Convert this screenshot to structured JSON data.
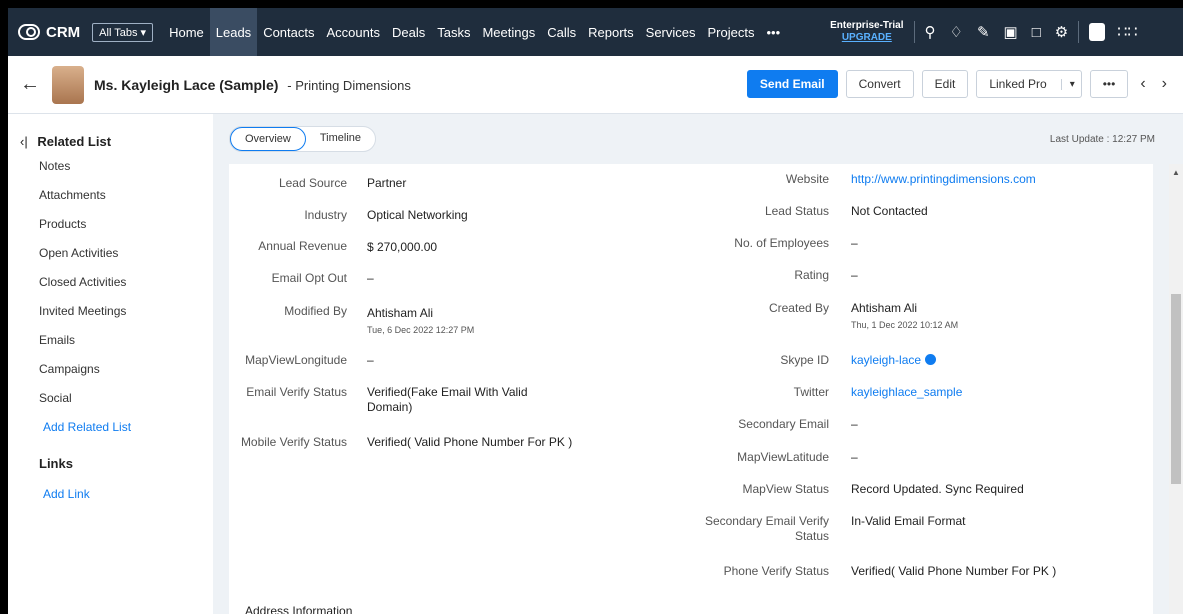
{
  "nav": {
    "logo": "CRM",
    "all_tabs": "All Tabs ▾",
    "items": [
      "Home",
      "Leads",
      "Contacts",
      "Accounts",
      "Deals",
      "Tasks",
      "Meetings",
      "Calls",
      "Reports",
      "Services",
      "Projects",
      "•••"
    ],
    "trial": "Enterprise-Trial",
    "upgrade": "UPGRADE"
  },
  "header": {
    "title": "Ms. Kayleigh Lace (Sample)",
    "company": "- Printing Dimensions",
    "send_email": "Send Email",
    "convert": "Convert",
    "edit": "Edit",
    "linked": "Linked Pro",
    "more": "•••"
  },
  "sidebar": {
    "title": "Related List",
    "items": [
      "Notes",
      "Attachments",
      "Products",
      "Open Activities",
      "Closed Activities",
      "Invited Meetings",
      "Emails",
      "Campaigns",
      "Social"
    ],
    "add_related": "Add Related List",
    "links_title": "Links",
    "add_link": "Add Link"
  },
  "tabs": {
    "overview": "Overview",
    "timeline": "Timeline"
  },
  "last_update": "Last Update : 12:27 PM",
  "left_fields": [
    {
      "label": "Lead Source",
      "value": "Partner"
    },
    {
      "label": "Industry",
      "value": "Optical Networking"
    },
    {
      "label": "Annual Revenue",
      "value": "$ 270,000.00"
    },
    {
      "label": "Email Opt Out",
      "value": "–"
    },
    {
      "label": "Modified By",
      "value": "Ahtisham Ali",
      "sub": "Tue, 6 Dec 2022 12:27 PM"
    },
    {
      "label": "MapViewLongitude",
      "value": "–"
    },
    {
      "label": "Email Verify Status",
      "value": "Verified(Fake Email With Valid Domain)"
    },
    {
      "label": "Mobile Verify Status",
      "value": "Verified( Valid Phone Number For PK )"
    }
  ],
  "right_fields": [
    {
      "label": "Website",
      "value": "http://www.printingdimensions.com"
    },
    {
      "label": "Lead Status",
      "value": "Not Contacted"
    },
    {
      "label": "No. of Employees",
      "value": "–"
    },
    {
      "label": "Rating",
      "value": "–"
    },
    {
      "label": "Created By",
      "value": "Ahtisham Ali",
      "sub": "Thu, 1 Dec 2022 10:12 AM"
    },
    {
      "label": "Skype ID",
      "value": "kayleigh-lace"
    },
    {
      "label": "Twitter",
      "value": "kayleighlace_sample"
    },
    {
      "label": "Secondary Email",
      "value": "–"
    },
    {
      "label": "MapViewLatitude",
      "value": "–"
    },
    {
      "label": "MapView Status",
      "value": "Record Updated. Sync Required"
    },
    {
      "label": "Secondary Email Verify Status",
      "value": "In-Valid Email Format"
    },
    {
      "label": "Phone Verify Status",
      "value": "Verified( Valid Phone Number For PK )"
    }
  ],
  "address_heading": "Address Information"
}
